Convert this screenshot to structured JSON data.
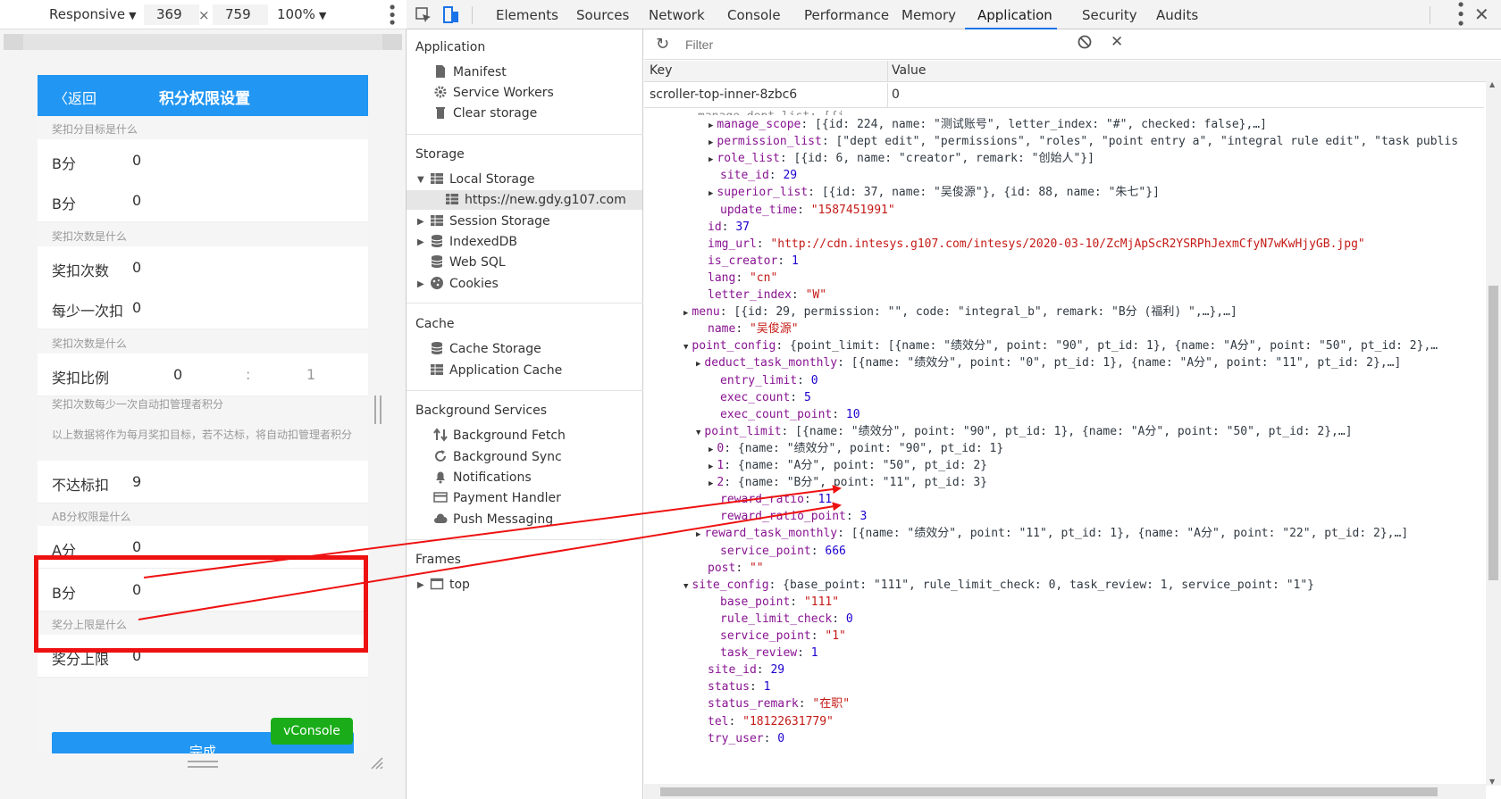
{
  "device_toolbar": {
    "mode": "Responsive",
    "width": "369",
    "times": "×",
    "height": "759",
    "zoom": "100%"
  },
  "devtools_tabs": [
    "Elements",
    "Sources",
    "Network",
    "Console",
    "Performance",
    "Memory",
    "Application",
    "Security",
    "Audits"
  ],
  "active_tab": "Application",
  "phone": {
    "back": "返回",
    "title": "积分权限设置",
    "section1": "奖扣分目标是什么",
    "row1_k": "B分",
    "row1_v": "0",
    "row2_k": "B分",
    "row2_v": "0",
    "section2": "奖扣次数是什么",
    "row3_k": "奖扣次数",
    "row3_v": "0",
    "row4_k": "每少一次扣",
    "row4_v": "0",
    "section3": "奖扣次数是什么",
    "row5_k": "奖扣比例",
    "row5_a": "0",
    "row5_sep": ":",
    "row5_b": "1",
    "section4": "奖扣次数每少一次自动扣管理者积分",
    "note": "以上数据将作为每月奖扣目标，若不达标，将自动扣管理者积分",
    "row6_k": "不达标扣",
    "row6_v": "9",
    "section5": "AB分权限是什么",
    "row7_k": "A分",
    "row7_v": "0",
    "row8_k": "B分",
    "row8_v": "0",
    "section6": "奖分上限是什么",
    "row9_k": "奖分上限",
    "row9_v": "0",
    "vconsole": "vConsole",
    "done": "完成"
  },
  "sidebar": {
    "application_title": "Application",
    "manifest": "Manifest",
    "service_workers": "Service Workers",
    "clear_storage": "Clear storage",
    "storage_title": "Storage",
    "local_storage": "Local Storage",
    "local_storage_origin": "https://new.gdy.g107.com",
    "session_storage": "Session Storage",
    "indexeddb": "IndexedDB",
    "web_sql": "Web SQL",
    "cookies": "Cookies",
    "cache_title": "Cache",
    "cache_storage": "Cache Storage",
    "application_cache": "Application Cache",
    "bg_title": "Background Services",
    "bg_fetch": "Background Fetch",
    "bg_sync": "Background Sync",
    "notifications": "Notifications",
    "payment_handler": "Payment Handler",
    "push_messaging": "Push Messaging",
    "frames_title": "Frames",
    "top": "top"
  },
  "kv": {
    "filter_placeholder": "Filter",
    "key_header": "Key",
    "value_header": "Value",
    "row_key": "scroller-top-inner-8zbc6",
    "row_value": "0"
  },
  "inspector_lines": [
    {
      "indent": 2,
      "tw": "▶",
      "k": "manage_scope",
      "v": "[{id: 224, name: \"测试账号\", letter_index: \"#\", checked: false},…]"
    },
    {
      "indent": 2,
      "tw": "▶",
      "k": "permission_list",
      "v": "[\"dept edit\", \"permissions\", \"roles\", \"point entry a\", \"integral rule edit\", \"task publis"
    },
    {
      "indent": 2,
      "tw": "▶",
      "k": "role_list",
      "v": "[{id: 6, name: \"creator\", remark: \"创始人\"}]"
    },
    {
      "indent": 2,
      "tw": "",
      "k": "site_id",
      "v": "29",
      "t": "n"
    },
    {
      "indent": 2,
      "tw": "▶",
      "k": "superior_list",
      "v": "[{id: 37, name: \"吴俊源\"}, {id: 88, name: \"朱七\"}]"
    },
    {
      "indent": 2,
      "tw": "",
      "k": "update_time",
      "v": "\"1587451991\"",
      "t": "s"
    },
    {
      "indent": 1,
      "tw": "",
      "k": "id",
      "v": "37",
      "t": "n"
    },
    {
      "indent": 1,
      "tw": "",
      "k": "img_url",
      "v": "\"http://cdn.intesys.g107.com/intesys/2020-03-10/ZcMjApScR2YSRPhJexmCfyN7wKwHjyGB.jpg\"",
      "t": "s"
    },
    {
      "indent": 1,
      "tw": "",
      "k": "is_creator",
      "v": "1",
      "t": "n"
    },
    {
      "indent": 1,
      "tw": "",
      "k": "lang",
      "v": "\"cn\"",
      "t": "s"
    },
    {
      "indent": 1,
      "tw": "",
      "k": "letter_index",
      "v": "\"W\"",
      "t": "s"
    },
    {
      "indent": 0,
      "tw": "▶",
      "k": "menu",
      "v": "[{id: 29, permission: \"\", code: \"integral_b\", remark: \"B分 (福利) \",…},…]"
    },
    {
      "indent": 1,
      "tw": "",
      "k": "name",
      "v": "\"吴俊源\"",
      "t": "s"
    },
    {
      "indent": 0,
      "tw": "▼",
      "k": "point_config",
      "v": "{point_limit: [{name: \"绩效分\", point: \"90\", pt_id: 1}, {name: \"A分\", point: \"50\", pt_id: 2},…"
    },
    {
      "indent": 1,
      "tw": "▶",
      "k": "deduct_task_monthly",
      "v": "[{name: \"绩效分\", point: \"0\", pt_id: 1}, {name: \"A分\", point: \"11\", pt_id: 2},…]"
    },
    {
      "indent": 2,
      "tw": "",
      "k": "entry_limit",
      "v": "0",
      "t": "n"
    },
    {
      "indent": 2,
      "tw": "",
      "k": "exec_count",
      "v": "5",
      "t": "n"
    },
    {
      "indent": 2,
      "tw": "",
      "k": "exec_count_point",
      "v": "10",
      "t": "n"
    },
    {
      "indent": 1,
      "tw": "▼",
      "k": "point_limit",
      "v": "[{name: \"绩效分\", point: \"90\", pt_id: 1}, {name: \"A分\", point: \"50\", pt_id: 2},…]"
    },
    {
      "indent": 2,
      "tw": "▶",
      "k": "0",
      "v": "{name: \"绩效分\", point: \"90\", pt_id: 1}"
    },
    {
      "indent": 2,
      "tw": "▶",
      "k": "1",
      "v": "{name: \"A分\", point: \"50\", pt_id: 2}"
    },
    {
      "indent": 2,
      "tw": "▶",
      "k": "2",
      "v": "{name: \"B分\", point: \"11\", pt_id: 3}"
    },
    {
      "indent": 2,
      "tw": "",
      "k": "reward_ratio",
      "v": "11",
      "t": "n"
    },
    {
      "indent": 2,
      "tw": "",
      "k": "reward_ratio_point",
      "v": "3",
      "t": "n"
    },
    {
      "indent": 1,
      "tw": "▶",
      "k": "reward_task_monthly",
      "v": "[{name: \"绩效分\", point: \"11\", pt_id: 1}, {name: \"A分\", point: \"22\", pt_id: 2},…]"
    },
    {
      "indent": 2,
      "tw": "",
      "k": "service_point",
      "v": "666",
      "t": "n"
    },
    {
      "indent": 1,
      "tw": "",
      "k": "post",
      "v": "\"\"",
      "t": "s"
    },
    {
      "indent": 0,
      "tw": "▼",
      "k": "site_config",
      "v": "{base_point: \"111\", rule_limit_check: 0, task_review: 1, service_point: \"1\"}"
    },
    {
      "indent": 2,
      "tw": "",
      "k": "base_point",
      "v": "\"111\"",
      "t": "s"
    },
    {
      "indent": 2,
      "tw": "",
      "k": "rule_limit_check",
      "v": "0",
      "t": "n"
    },
    {
      "indent": 2,
      "tw": "",
      "k": "service_point",
      "v": "\"1\"",
      "t": "s"
    },
    {
      "indent": 2,
      "tw": "",
      "k": "task_review",
      "v": "1",
      "t": "n"
    },
    {
      "indent": 1,
      "tw": "",
      "k": "site_id",
      "v": "29",
      "t": "n"
    },
    {
      "indent": 1,
      "tw": "",
      "k": "status",
      "v": "1",
      "t": "n"
    },
    {
      "indent": 1,
      "tw": "",
      "k": "status_remark",
      "v": "\"在职\"",
      "t": "s"
    },
    {
      "indent": 1,
      "tw": "",
      "k": "tel",
      "v": "\"18122631779\"",
      "t": "s"
    },
    {
      "indent": 1,
      "tw": "",
      "k": "try_user",
      "v": "0",
      "t": "n"
    }
  ],
  "colors": {
    "accent_blue": "#2196f3",
    "annotation_red": "#ee1111",
    "vconsole_green": "#1aad19"
  }
}
